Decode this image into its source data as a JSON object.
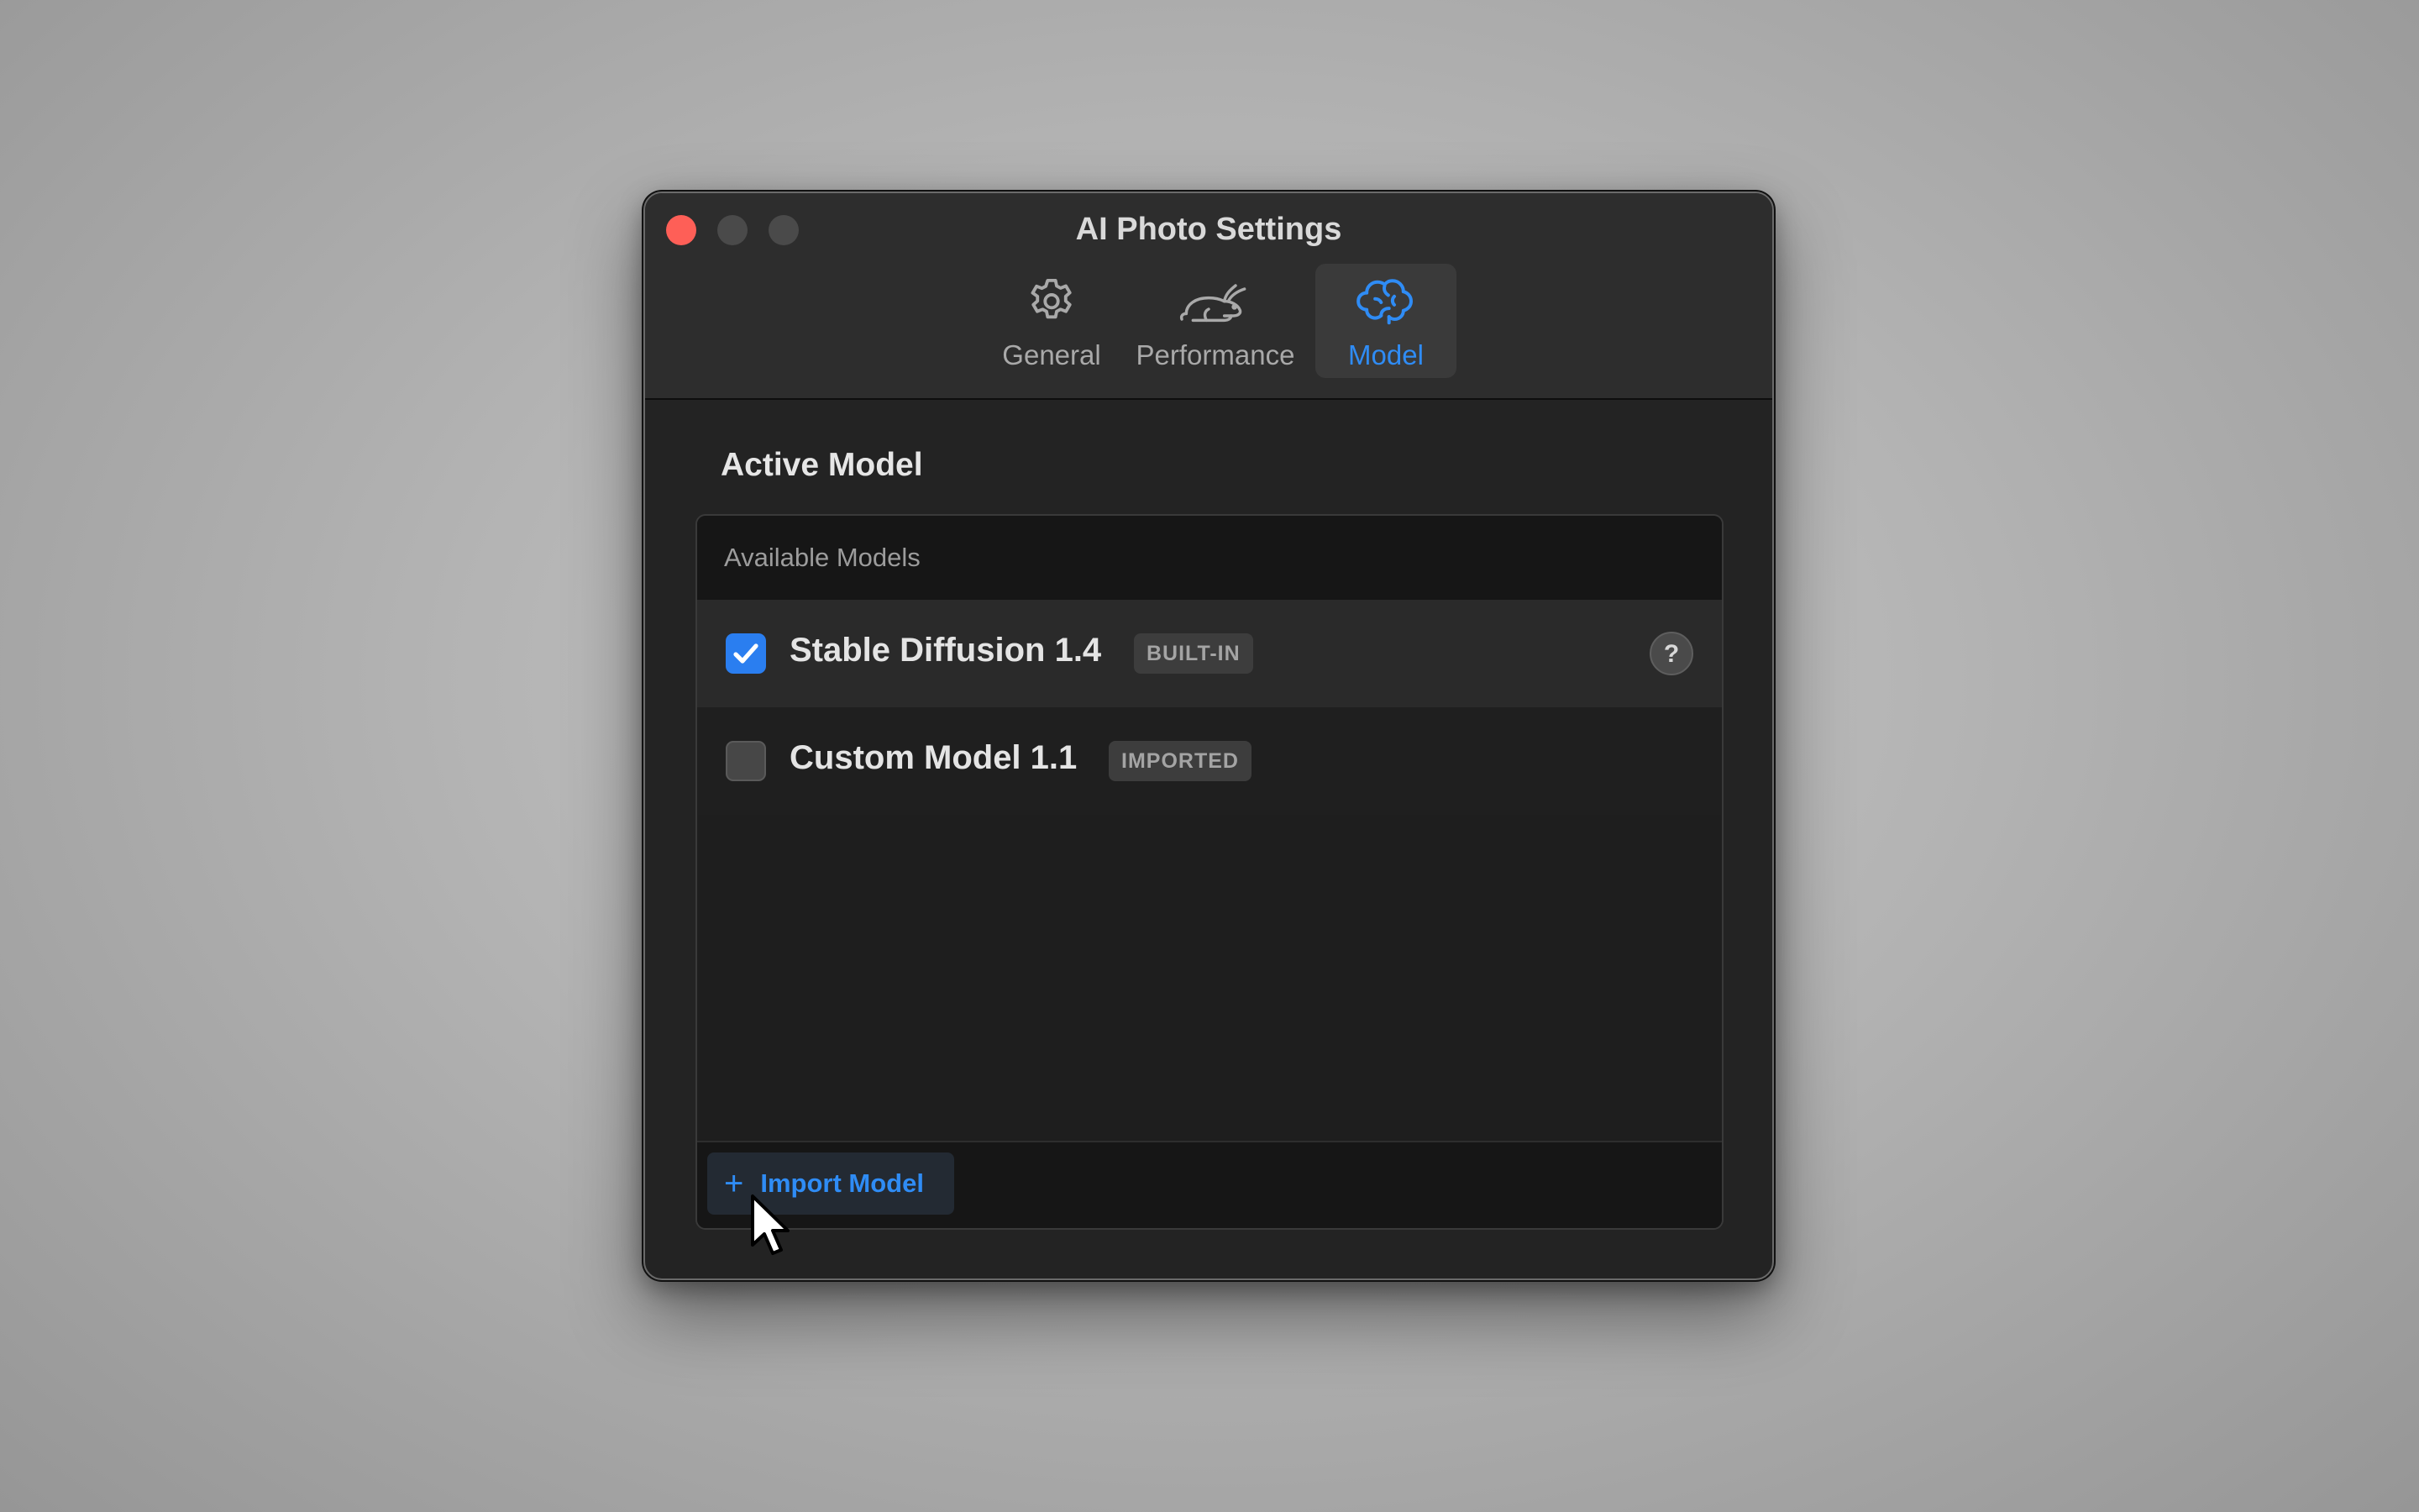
{
  "window": {
    "title": "AI Photo Settings"
  },
  "tabs": [
    {
      "label": "General",
      "icon": "gear-icon",
      "selected": false
    },
    {
      "label": "Performance",
      "icon": "rabbit-icon",
      "selected": true
    },
    {
      "label": "Model",
      "icon": "brain-icon",
      "selected": true
    }
  ],
  "section": {
    "title": "Active Model"
  },
  "models_list": {
    "header": "Available Models",
    "items": [
      {
        "name": "Stable Diffusion 1.4",
        "badge": "BUILT-IN",
        "checked": true,
        "has_help": true
      },
      {
        "name": "Custom Model 1.1",
        "badge": "IMPORTED",
        "checked": false,
        "has_help": false
      }
    ],
    "help_glyph": "?"
  },
  "footer": {
    "import_plus": "+",
    "import_label": "Import Model"
  },
  "colors": {
    "accent": "#2f8cf5",
    "close": "#fe5f57",
    "checkbox_on": "#2a7ef0"
  }
}
